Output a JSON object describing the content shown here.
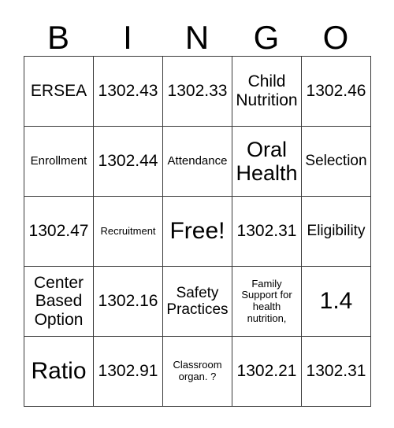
{
  "card": {
    "header_letters": [
      "B",
      "I",
      "N",
      "G",
      "O"
    ],
    "rows": [
      [
        {
          "text": "ERSEA",
          "size": "lg"
        },
        {
          "text": "1302.43",
          "size": "lg"
        },
        {
          "text": "1302.33",
          "size": "lg"
        },
        {
          "text": "Child Nutrition",
          "size": "lg"
        },
        {
          "text": "1302.46",
          "size": "lg"
        }
      ],
      [
        {
          "text": "Enrollment",
          "size": "sm"
        },
        {
          "text": "1302.44",
          "size": "lg"
        },
        {
          "text": "Attendance",
          "size": "sm"
        },
        {
          "text": "Oral Health",
          "size": "xl"
        },
        {
          "text": "Selection",
          "size": "md"
        }
      ],
      [
        {
          "text": "1302.47",
          "size": "lg"
        },
        {
          "text": "Recruitment",
          "size": "xs"
        },
        {
          "text": "Free!",
          "size": "xxl",
          "free_space": true
        },
        {
          "text": "1302.31",
          "size": "lg"
        },
        {
          "text": "Eligibility",
          "size": "md"
        }
      ],
      [
        {
          "text": "Center Based Option",
          "size": "lg"
        },
        {
          "text": "1302.16",
          "size": "lg"
        },
        {
          "text": "Safety Practices",
          "size": "md"
        },
        {
          "text": "Family Support for health nutrition,",
          "size": "xs"
        },
        {
          "text": "1.4",
          "size": "xxl"
        }
      ],
      [
        {
          "text": "Ratio",
          "size": "xxl"
        },
        {
          "text": "1302.91",
          "size": "lg"
        },
        {
          "text": "Classroom organ. ?",
          "size": "xs"
        },
        {
          "text": "1302.21",
          "size": "lg"
        },
        {
          "text": "1302.31",
          "size": "lg"
        }
      ]
    ]
  }
}
